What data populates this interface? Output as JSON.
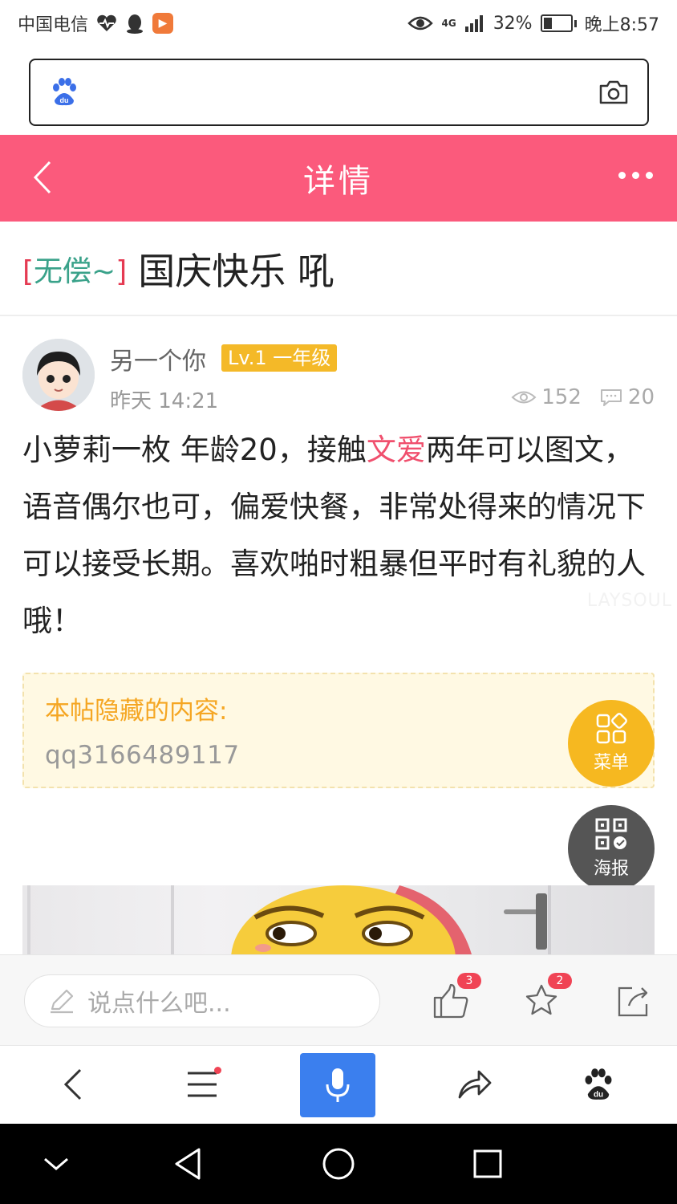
{
  "status_bar": {
    "carrier": "中国电信",
    "battery_percent": "32%",
    "battery_level": 0.32,
    "time": "晚上8:57",
    "network": "4G"
  },
  "search": {
    "placeholder": "",
    "logo_icon": "baidu-paw-icon",
    "camera_icon": "camera-icon"
  },
  "header": {
    "title": "详情",
    "back_icon": "chevron-left-icon",
    "more_icon": "more-dots-icon",
    "background": "#fb5a7c"
  },
  "post": {
    "tag_open": "[",
    "tag": "无偿~",
    "tag_close": "]",
    "title": "国庆快乐 吼",
    "author": "另一个你",
    "level": "Lv.1 一年级",
    "time": "昨天 14:21",
    "views": "152",
    "comments": "20",
    "content": {
      "part1": "小萝莉一枚 年龄20，接触",
      "highlight": "文爱",
      "part2": "两年可以图文，语音偶尔也可，偏爱快餐，非常处得来的情况下可以接受长期。喜欢啪时粗暴但平时有礼貌的人哦！"
    },
    "watermark": "LAYSOUL",
    "hidden_label": "本帖隐藏的内容:",
    "hidden_value": "qq3166489117"
  },
  "fabs": {
    "menu_label": "菜单",
    "poster_label": "海报"
  },
  "comment_bar": {
    "placeholder": "说点什么吧...",
    "like_count": "3",
    "favorite_count": "2"
  },
  "colors": {
    "accent_pink": "#fb5a7c",
    "level_badge": "#f4b928",
    "menu_fab": "#f6b820",
    "poster_fab": "#555555",
    "mic_button": "#3b7fee",
    "tag_green": "#3aa28a"
  }
}
